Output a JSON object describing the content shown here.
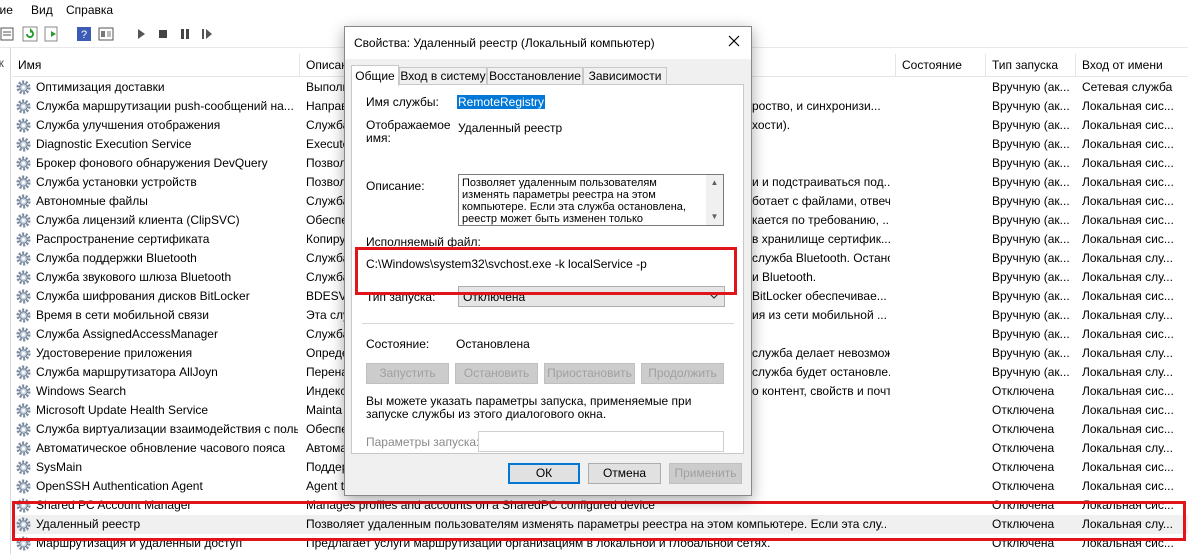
{
  "menubar": {
    "items": [
      "зие",
      "Вид",
      "Справка"
    ]
  },
  "left_panel": {
    "label": "ок"
  },
  "table": {
    "headers": [
      "Имя",
      "Описан",
      "Состояние",
      "Тип запуска",
      "Вход от имени"
    ],
    "rows": [
      {
        "name": "Оптимизация доставки",
        "desc": "Выполн",
        "status": "",
        "startup": "Вручную (ак...",
        "logon": "Сетевая служба"
      },
      {
        "name": "Служба маршрутизации push-сообщений на...",
        "desc": "Направ",
        "status": "",
        "startup": "Вручную (ак...",
        "logon": "Локальная сис..."
      },
      {
        "name": "Служба улучшения отображения",
        "desc": "Служба",
        "status": "",
        "startup": "Вручную (ак...",
        "logon": "Локальная сис..."
      },
      {
        "name": "Diagnostic Execution Service",
        "desc": "Execute",
        "status": "",
        "startup": "Вручную (ак...",
        "logon": "Локальная сис..."
      },
      {
        "name": "Брокер фонового обнаружения DevQuery",
        "desc": "Позвол",
        "status": "",
        "startup": "Вручную (ак...",
        "logon": "Локальная сис..."
      },
      {
        "name": "Служба установки устройств",
        "desc": "Позвол",
        "status": "",
        "startup": "Вручную (ак...",
        "logon": "Локальная сис..."
      },
      {
        "name": "Автономные файлы",
        "desc": "Служба",
        "status": "",
        "startup": "Вручную (ак...",
        "logon": "Локальная сис..."
      },
      {
        "name": "Служба лицензий клиента (ClipSVC)",
        "desc": "Обеспе",
        "status": "",
        "startup": "Вручную (ак...",
        "logon": "Локальная сис..."
      },
      {
        "name": "Распространение сертификата",
        "desc": "Копиру",
        "status": "",
        "startup": "Вручную (ак...",
        "logon": "Локальная сис..."
      },
      {
        "name": "Служба поддержки Bluetooth",
        "desc": "Служба",
        "status": "",
        "startup": "Вручную (ак...",
        "logon": "Локальная слу..."
      },
      {
        "name": "Служба звукового шлюза Bluetooth",
        "desc": "Служба",
        "status": "",
        "startup": "Вручную (ак...",
        "logon": "Локальная слу..."
      },
      {
        "name": "Служба шифрования дисков BitLocker",
        "desc": "BDESVC",
        "status": "",
        "startup": "Вручную (ак...",
        "logon": "Локальная сис..."
      },
      {
        "name": "Время в сети мобильной связи",
        "desc": "Эта слу",
        "status": "",
        "startup": "Вручную (ак...",
        "logon": "Локальная слу..."
      },
      {
        "name": "Служба AssignedAccessManager",
        "desc": "Служба",
        "status": "",
        "startup": "Вручную (ак...",
        "logon": "Локальная сис..."
      },
      {
        "name": "Удостоверение приложения",
        "desc": "Опреде",
        "status": "",
        "startup": "Вручную (ак...",
        "logon": "Локальная слу..."
      },
      {
        "name": "Служба маршрутизатора AllJoyn",
        "desc": "Перена",
        "status": "",
        "startup": "Вручную (ак...",
        "logon": "Локальная слу..."
      },
      {
        "name": "Windows Search",
        "desc": "Индекс",
        "status": "",
        "startup": "Отключена",
        "logon": "Локальная сис..."
      },
      {
        "name": "Microsoft Update Health Service",
        "desc": "Mainta",
        "status": "",
        "startup": "Отключена",
        "logon": "Локальная сис..."
      },
      {
        "name": "Служба виртуализации взаимодействия с поль...",
        "desc": "Обеспе",
        "status": "",
        "startup": "Отключена",
        "logon": "Локальная сис..."
      },
      {
        "name": "Автоматическое обновление часового пояса",
        "desc": "Автома",
        "status": "",
        "startup": "Отключена",
        "logon": "Локальная слу..."
      },
      {
        "name": "SysMain",
        "desc": "Поддер",
        "status": "",
        "startup": "Отключена",
        "logon": "Локальная сис..."
      },
      {
        "name": "OpenSSH Authentication Agent",
        "desc": "Agent t",
        "status": "",
        "startup": "Отключена",
        "logon": "Локальная сис..."
      },
      {
        "name": "Shared PC Account Manager",
        "desc": "Manages profiles and accounts on a SharedPC configured device",
        "status": "",
        "startup": "Отключена",
        "logon": "Локальная сис..."
      },
      {
        "name": "Удаленный реестр",
        "desc": "Позволяет удаленным пользователям изменять параметры реестра на этом компьютере. Если эта слу...",
        "status": "",
        "startup": "Отключена",
        "logon": "Локальная слу...",
        "selected": true
      },
      {
        "name": "Маршрутизация и удаленный доступ",
        "desc": "Предлагает услуги маршрутизации организациям в локальной и глобальной сетях.",
        "status": "",
        "startup": "Отключена",
        "logon": "Локальная сис..."
      }
    ],
    "desc_tails": [
      "",
      "роство, и синхронизи...",
      "хости).",
      "",
      "",
      "и и подстраиваться под...",
      "ботает с файлами, отвечает...",
      "кается по требованию, ...",
      "в хранилище сертифик...",
      "служба Bluetooth. Останов...",
      "и Bluetooth.",
      "BitLocker обеспечивае...",
      "ия из сети мобильной ...",
      "",
      "служба делает невозможны...",
      "служба будет остановле...",
      "о контент, свойств и почт...",
      "",
      "",
      "",
      "",
      "",
      "",
      "",
      ""
    ]
  },
  "dialog": {
    "title": "Свойства: Удаленный реестр (Локальный компьютер)",
    "tabs": [
      "Общие",
      "Вход в систему",
      "Восстановление",
      "Зависимости"
    ],
    "service_name_label": "Имя службы:",
    "service_name": "RemoteRegistry",
    "display_name_label_1": "Отображаемое",
    "display_name_label_2": "имя:",
    "display_name": "Удаленный реестр",
    "description_label": "Описание:",
    "description": "Позволяет удаленным пользователям изменять параметры реестра на этом компьютере. Если эта служба остановлена, реестр может быть изменен только",
    "exe_label": "Исполняемый файл:",
    "exe_path": "C:\\Windows\\system32\\svchost.exe -k localService -p",
    "startup_label": "Тип запуска:",
    "startup_value": "Отключена",
    "status_label": "Состояние:",
    "status_value": "Остановлена",
    "buttons_service": [
      "Запустить",
      "Остановить",
      "Приостановить",
      "Продолжить"
    ],
    "hint": "Вы можете указать параметры запуска, применяемые при запуске службы из этого диалогового окна.",
    "params_label": "Параметры запуска:",
    "params_value": "",
    "ok": "ОК",
    "cancel": "Отмена",
    "apply": "Применить"
  },
  "colors": {
    "highlight": "#e0141b",
    "selection": "#0078d7"
  }
}
